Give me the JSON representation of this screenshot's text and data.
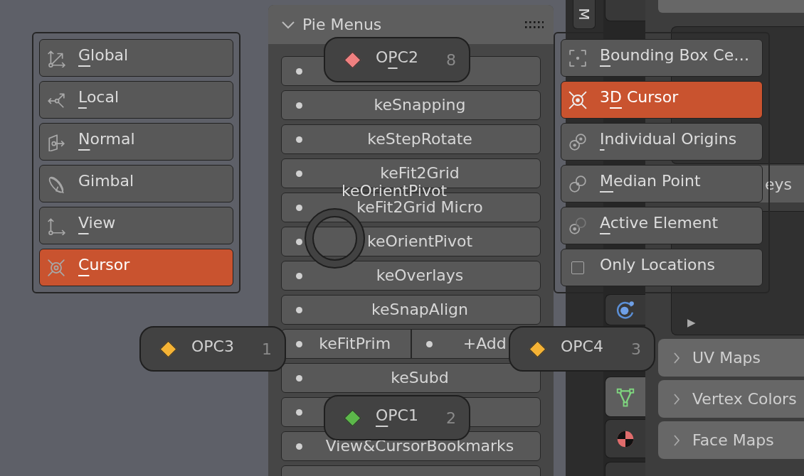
{
  "center_panel": {
    "title": "Pie Menus",
    "expanded": true,
    "rows": [
      {
        "cells": [
          {}
        ]
      },
      {
        "cells": [
          {
            "label": "keSnapping"
          }
        ]
      },
      {
        "cells": [
          {
            "label": "keStepRotate"
          }
        ]
      },
      {
        "cells": [
          {
            "label": "keFit2Grid"
          }
        ]
      },
      {
        "cells": [
          {
            "label": "keFit2Grid Micro"
          }
        ]
      },
      {
        "cells": [
          {
            "label": "keOrientPivot"
          }
        ]
      },
      {
        "cells": [
          {
            "label": "keOverlays"
          }
        ]
      },
      {
        "cells": [
          {
            "label": "keSnapAlign"
          }
        ]
      },
      {
        "cells": [
          {
            "label": "keFitPrim"
          },
          {
            "label": "+Add"
          }
        ]
      },
      {
        "cells": [
          {
            "label": "keSubd"
          }
        ]
      },
      {
        "cells": [
          {}
        ]
      },
      {
        "cells": [
          {
            "label": "View&CursorBookmarks"
          }
        ]
      },
      {
        "cells": [
          {}
        ]
      }
    ]
  },
  "vertical_tab": {
    "label": "M"
  },
  "property_tabs": [
    {
      "selected": false
    },
    {
      "selected": false
    },
    {
      "selected": true
    },
    {
      "selected": false
    },
    {
      "selected": false
    }
  ],
  "properties": {
    "covered_header": "eys",
    "list_toggle": "▶",
    "panels": [
      {
        "title": "UV Maps",
        "expanded": false
      },
      {
        "title": "Vertex Colors",
        "expanded": false
      },
      {
        "title": "Face Maps",
        "expanded": false
      }
    ]
  },
  "pie_title": "keOrientPivot",
  "pie_left": {
    "items": [
      {
        "label": "Global",
        "underline_first": true,
        "underline_second": false,
        "selected": false
      },
      {
        "label": "Local",
        "underline_first": true,
        "underline_second": false,
        "selected": false
      },
      {
        "label": "Normal",
        "underline_first": true,
        "underline_second": false,
        "selected": false
      },
      {
        "label": "Gimbal",
        "underline_first": false,
        "underline_second": false,
        "selected": false
      },
      {
        "label": "View",
        "underline_first": true,
        "underline_second": false,
        "selected": false
      },
      {
        "label": "Cursor",
        "underline_first": true,
        "underline_second": false,
        "selected": true
      }
    ]
  },
  "pie_right": {
    "items": [
      {
        "kind": "option",
        "label": "Bounding Box Ce…",
        "underline_first": true,
        "underline_second": false,
        "selected": false
      },
      {
        "kind": "option",
        "label": "3D Cursor",
        "underline_first": false,
        "underline_second": true,
        "selected": true
      },
      {
        "kind": "option",
        "label": "Individual Origins",
        "underline_first": true,
        "underline_second": false,
        "selected": false
      },
      {
        "kind": "option",
        "label": "Median Point",
        "underline_first": true,
        "underline_second": false,
        "selected": false
      },
      {
        "kind": "option",
        "label": "Active Element",
        "underline_first": true,
        "underline_second": false,
        "selected": false
      },
      {
        "kind": "checkbox",
        "label": "Only Locations",
        "underline_first": false,
        "underline_second": false,
        "checked": false
      }
    ]
  },
  "pie_buttons": [
    {
      "label": "OPC2",
      "underline_first": false,
      "underline_second": true,
      "hotkey": "8",
      "color": "#f08080"
    },
    {
      "label": "OPC3",
      "underline_first": false,
      "underline_second": false,
      "hotkey": "1",
      "color": "#f5b335"
    },
    {
      "label": "OPC4",
      "underline_first": false,
      "underline_second": false,
      "hotkey": "3",
      "color": "#f5b335"
    },
    {
      "label": "OPC1",
      "underline_first": true,
      "underline_second": false,
      "hotkey": "2",
      "color": "#5cb84a"
    }
  ]
}
